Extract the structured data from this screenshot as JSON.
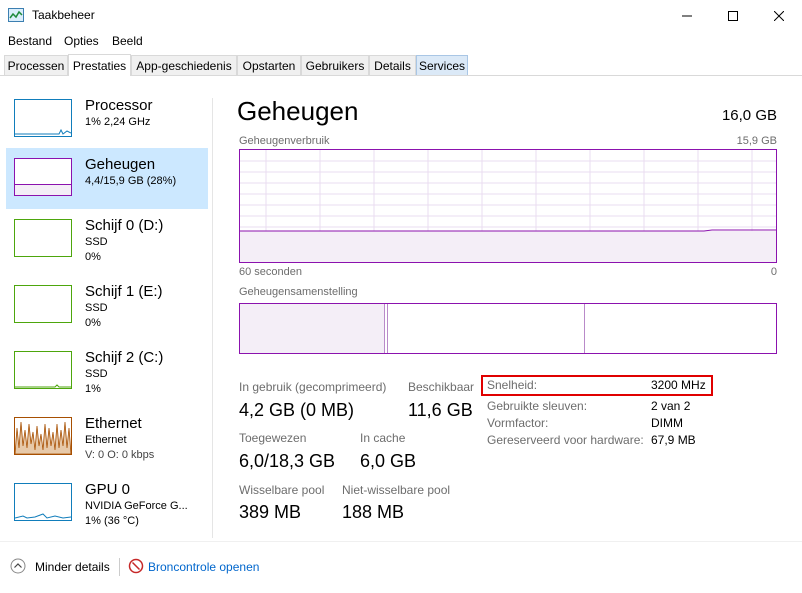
{
  "window": {
    "title": "Taakbeheer"
  },
  "menu": [
    "Bestand",
    "Opties",
    "Beeld"
  ],
  "tabs": [
    "Processen",
    "Prestaties",
    "App-geschiedenis",
    "Opstarten",
    "Gebruikers",
    "Details",
    "Services"
  ],
  "resources": [
    {
      "name": "Processor",
      "lines": [
        "1% 2,24 GHz"
      ]
    },
    {
      "name": "Geheugen",
      "lines": [
        "4,4/15,9 GB (28%)"
      ]
    },
    {
      "name": "Schijf 0 (D:)",
      "lines": [
        "SSD",
        "0%"
      ]
    },
    {
      "name": "Schijf 1 (E:)",
      "lines": [
        "SSD",
        "0%"
      ]
    },
    {
      "name": "Schijf 2 (C:)",
      "lines": [
        "SSD",
        "1%"
      ]
    },
    {
      "name": "Ethernet",
      "lines": [
        "Ethernet",
        "V: 0 O: 0 kbps"
      ]
    },
    {
      "name": "GPU 0",
      "lines": [
        "NVIDIA GeForce G...",
        "1% (36 °C)"
      ]
    }
  ],
  "main": {
    "title": "Geheugen",
    "total": "16,0 GB",
    "usage_label": "Geheugenverbruik",
    "usage_max": "15,9 GB",
    "time_label": "60 seconden",
    "time_end": "0",
    "composition_label": "Geheugensamenstelling",
    "usage_fraction": 0.28
  },
  "stats": {
    "in_use_label": "In gebruik (gecomprimeerd)",
    "in_use_value": "4,2 GB (0 MB)",
    "available_label": "Beschikbaar",
    "available_value": "11,6 GB",
    "committed_label": "Toegewezen",
    "committed_value": "6,0/18,3 GB",
    "cached_label": "In cache",
    "cached_value": "6,0 GB",
    "paged_label": "Wisselbare pool",
    "paged_value": "389 MB",
    "nonpaged_label": "Niet-wisselbare pool",
    "nonpaged_value": "188 MB"
  },
  "details": [
    {
      "key": "Snelheid:",
      "value": "3200 MHz"
    },
    {
      "key": "Gebruikte sleuven:",
      "value": "2 van 2"
    },
    {
      "key": "Vormfactor:",
      "value": "DIMM"
    },
    {
      "key": "Gereserveerd voor hardware:",
      "value": "67,9 MB"
    }
  ],
  "bottom": {
    "fewer_details": "Minder details",
    "open_monitor": "Broncontrole openen"
  },
  "colors": {
    "memory": "#8b12ae",
    "cpu": "#117dbb",
    "disk": "#4da60c",
    "ethernet": "#a74f01",
    "link": "#0066cc",
    "highlight": "#e00000"
  }
}
